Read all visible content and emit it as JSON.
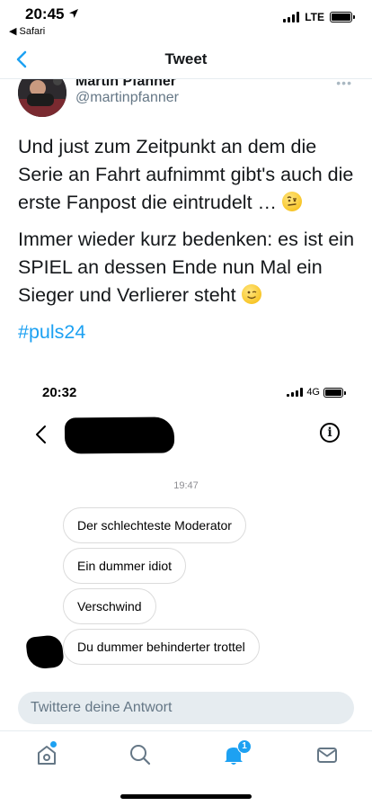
{
  "status_bar": {
    "time": "20:45",
    "back_app": "◀ Safari",
    "network": "LTE"
  },
  "header": {
    "title": "Tweet"
  },
  "author": {
    "name": "Martin Pfanner",
    "handle": "@martinpfanner"
  },
  "tweet": {
    "paragraph1": "Und just zum Zeitpunkt an dem die Serie an Fahrt aufnimmt gibt's auch die erste Fanpost die eintrudelt … ",
    "paragraph2": "Immer wieder kurz bedenken: es ist ein SPIEL an dessen Ende nun Mal ein Sieger und Verlierer steht ",
    "hashtag": "#puls24"
  },
  "embedded_screenshot": {
    "time": "20:32",
    "network": "4G",
    "message_time": "19:47",
    "messages": [
      "Der schlechteste Moderator",
      "Ein dummer idiot",
      "Verschwind",
      "Du dummer behinderter trottel"
    ]
  },
  "reply": {
    "placeholder": "Twittere deine Antwort"
  },
  "tabbar": {
    "notifications_badge": "1"
  },
  "colors": {
    "accent": "#1da1f2",
    "text": "#14171a",
    "secondary_text": "#657786"
  }
}
